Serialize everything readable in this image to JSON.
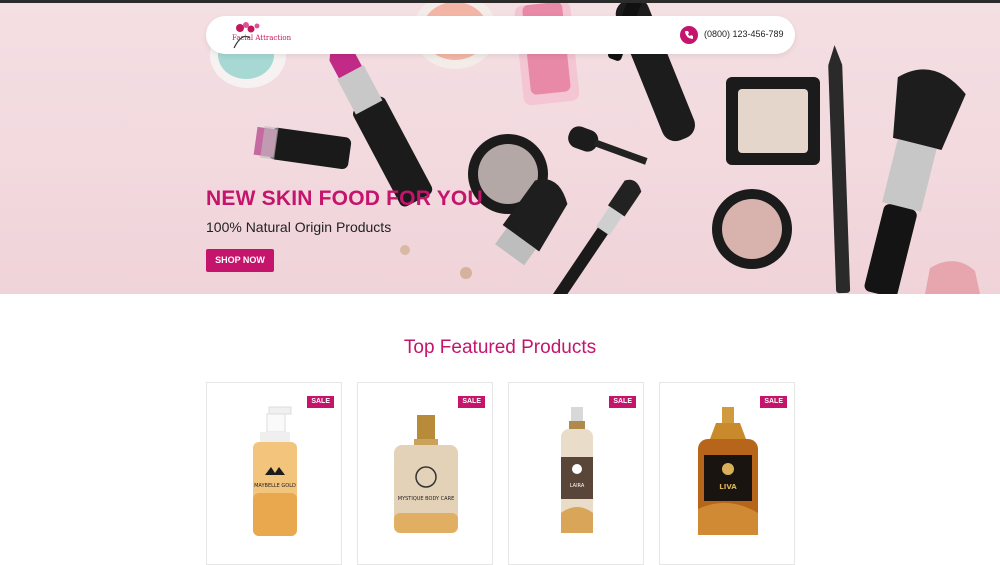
{
  "header": {
    "logo_text": "Facial Attraction",
    "phone": "(0800) 123-456-789"
  },
  "hero": {
    "title": "NEW SKIN FOOD FOR YOU",
    "subtitle": "100% Natural Origin Products",
    "cta": "SHOP NOW"
  },
  "featured": {
    "title": "Top Featured Products",
    "products": [
      {
        "badge": "SALE",
        "label": "MAYBELLE GOLD"
      },
      {
        "badge": "SALE",
        "label": "MYSTIQUE BODY CARE"
      },
      {
        "badge": "SALE",
        "label": "LAIRA"
      },
      {
        "badge": "SALE",
        "label": "LIVA"
      }
    ]
  },
  "colors": {
    "accent": "#c5146b",
    "hero_bg": "#f2d9de"
  }
}
